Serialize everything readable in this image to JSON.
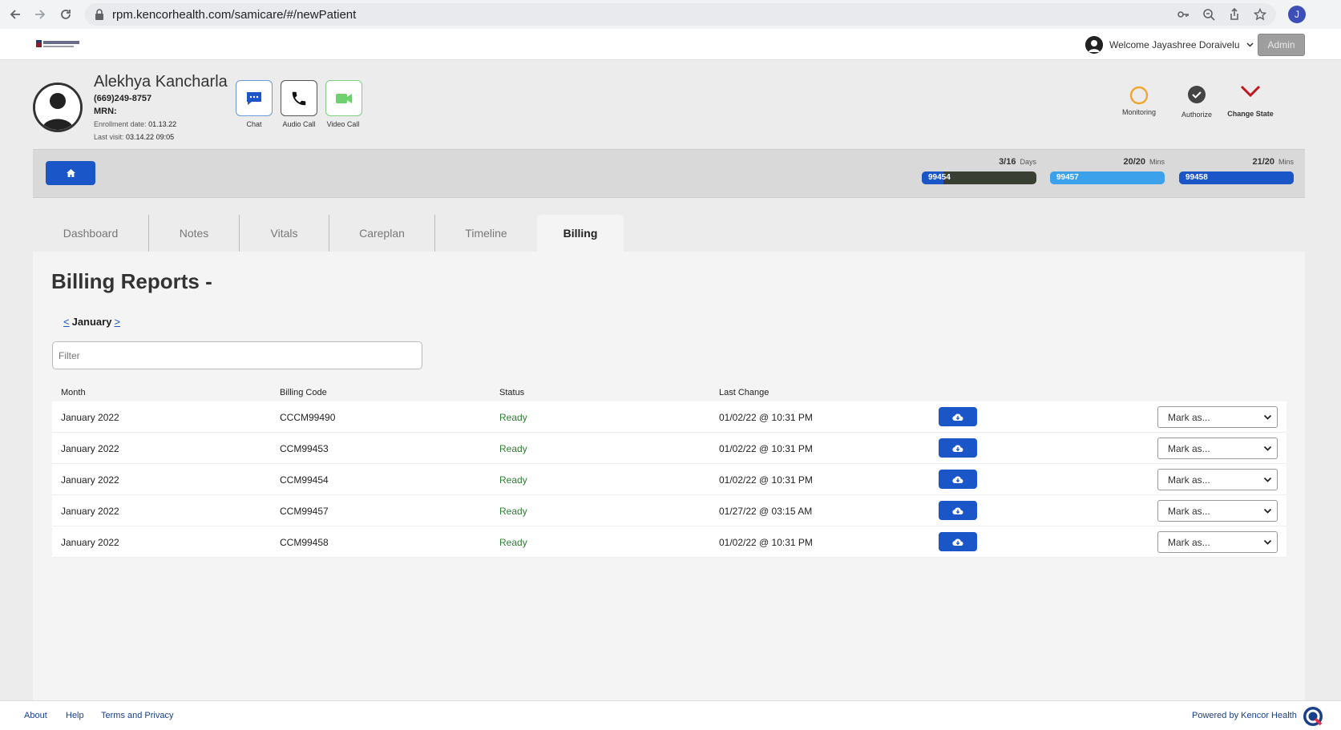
{
  "browser": {
    "url": "rpm.kencorhealth.com/samicare/#/newPatient",
    "profile_initial": "J"
  },
  "header": {
    "welcome": "Welcome Jayashree Doraivelu",
    "admin_label": "Admin"
  },
  "patient": {
    "name": "Alekhya Kancharla",
    "phone": "(669)249-8757",
    "mrn_label": "MRN:",
    "enrollment_label": "Enrollment date:",
    "enrollment_date": "01.13.22",
    "last_visit_label": "Last visit:",
    "last_visit": "03.14.22 09:05"
  },
  "comm": {
    "chat": "Chat",
    "audio": "Audio Call",
    "video": "Video Call"
  },
  "states": {
    "monitoring": "Monitoring",
    "authorize": "Authorize",
    "change_state": "Change State"
  },
  "progress": [
    {
      "code": "99454",
      "value": "3/16",
      "unit": "Days",
      "fraction": 0.19,
      "color": "#3a3f33",
      "fill": "#1a56c8"
    },
    {
      "code": "99457",
      "value": "20/20",
      "unit": "Mins",
      "fraction": 1.0,
      "color": "#3aa1ea",
      "fill": "#3aa1ea"
    },
    {
      "code": "99458",
      "value": "21/20",
      "unit": "Mins",
      "fraction": 1.0,
      "color": "#1a56c8",
      "fill": "#1a56c8"
    }
  ],
  "tabs": [
    "Dashboard",
    "Notes",
    "Vitals",
    "Careplan",
    "Timeline",
    "Billing"
  ],
  "active_tab": "Billing",
  "billing": {
    "title": "Billing Reports -",
    "prev": "<",
    "month": "January",
    "next": ">",
    "filter_placeholder": "Filter",
    "columns": [
      "Month",
      "Billing Code",
      "Status",
      "Last Change"
    ],
    "mark_placeholder": "Mark as...",
    "rows": [
      {
        "month": "January 2022",
        "code": "CCCM99490",
        "status": "Ready",
        "last_change": "01/02/22 @ 10:31 PM"
      },
      {
        "month": "January 2022",
        "code": "CCM99453",
        "status": "Ready",
        "last_change": "01/02/22 @ 10:31 PM"
      },
      {
        "month": "January 2022",
        "code": "CCM99454",
        "status": "Ready",
        "last_change": "01/02/22 @ 10:31 PM"
      },
      {
        "month": "January 2022",
        "code": "CCM99457",
        "status": "Ready",
        "last_change": "01/27/22 @ 03:15 AM"
      },
      {
        "month": "January 2022",
        "code": "CCM99458",
        "status": "Ready",
        "last_change": "01/02/22 @ 10:31 PM"
      }
    ]
  },
  "footer": {
    "about": "About",
    "help": "Help",
    "terms": "Terms and Privacy",
    "powered": "Powered by Kencor Health"
  }
}
